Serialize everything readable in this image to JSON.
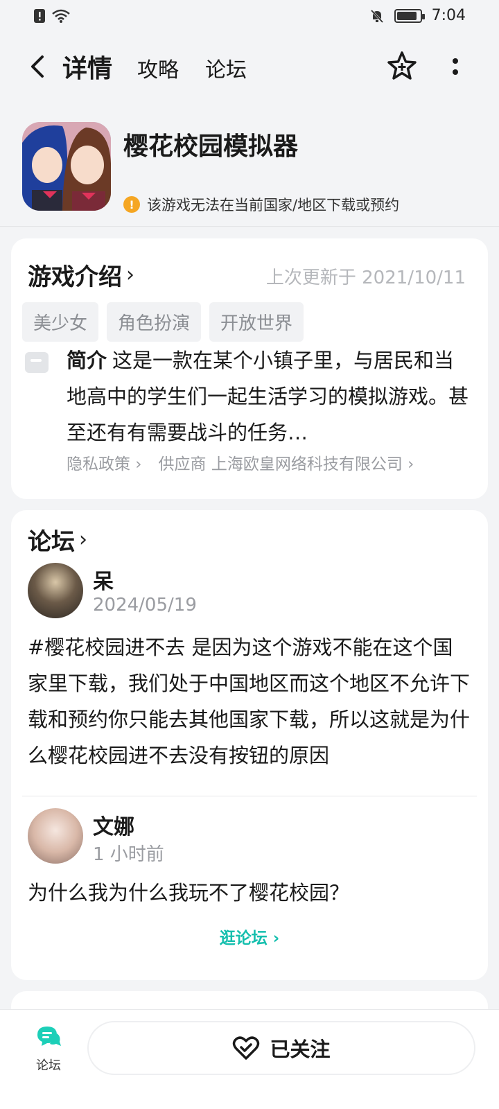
{
  "status_bar": {
    "time": "7:04",
    "battery_level": 0.9
  },
  "nav": {
    "tabs": [
      {
        "label": "详情",
        "active": true
      },
      {
        "label": "攻略",
        "active": false
      },
      {
        "label": "论坛",
        "active": false
      }
    ]
  },
  "app": {
    "title": "樱花校园模拟器",
    "notice": "该游戏无法在当前国家/地区下载或预约"
  },
  "intro": {
    "title": "游戏介绍",
    "updated": "上次更新于 2021/10/11",
    "tags": [
      "美少女",
      "角色扮演",
      "开放世界"
    ],
    "desc_label": "简介",
    "desc_text": "这是一款在某个小镇子里，与居民和当地高中的学生们一起生活学习的模拟游戏。甚至还有有需要战斗的任务…",
    "privacy_link": "隐私政策",
    "supplier_link": "供应商 上海欧皇网络科技有限公司"
  },
  "forum": {
    "title": "论坛",
    "posts": [
      {
        "author": "呆",
        "time": "2024/05/19",
        "body": "#樱花校园进不去 是因为这个游戏不能在这个国家里下载，我们处于中国地区而这个地区不允许下载和预约你只能去其他国家下载，所以这就是为什么樱花校园进不去没有按钮的原因"
      },
      {
        "author": "文娜",
        "time": "1 小时前",
        "body": "为什么我为什么我玩不了樱花校园？"
      }
    ],
    "more_link": "逛论坛"
  },
  "bottom": {
    "forum_label": "论坛",
    "follow_label": "已关注"
  },
  "colors": {
    "accent": "#1ccfb8",
    "link": "#15bfae",
    "warning": "#f5a623"
  }
}
